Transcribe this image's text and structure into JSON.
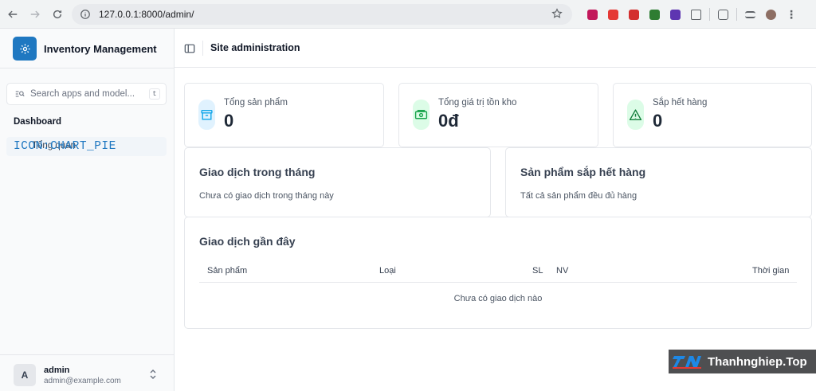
{
  "browser": {
    "url": "127.0.0.1:8000/admin/",
    "extension_colors": [
      "#c2185b",
      "#e53935",
      "#d32f2f",
      "#2e7d32",
      "#5e35b1",
      "#5f6368",
      "#5f6368",
      "#5f6368",
      "#8d6e63",
      "#5f6368"
    ]
  },
  "sidebar": {
    "brand": "Inventory Management",
    "search_placeholder": "Search apps and model...",
    "search_shortcut": "t",
    "section_title": "Dashboard",
    "nav_item_icon_text": "ICON:CHART_PIE",
    "nav_item_label": "Tổng quan",
    "user": {
      "initial": "A",
      "name": "admin",
      "email": "admin@example.com"
    }
  },
  "header": {
    "title": "Site administration"
  },
  "stats": [
    {
      "label": "Tổng sản phẩm",
      "value": "0",
      "icon": "archive-box-icon",
      "icon_color": "#0ea5e9",
      "icon_bg": "#e0f2fe"
    },
    {
      "label": "Tổng giá trị tồn kho",
      "value": "0đ",
      "icon": "banknote-icon",
      "icon_color": "#16a34a",
      "icon_bg": "#dcfce7"
    },
    {
      "label": "Sắp hết hàng",
      "value": "0",
      "icon": "warning-triangle-icon",
      "icon_color": "#15803d",
      "icon_bg": "#dcfce7"
    }
  ],
  "panels": {
    "monthly": {
      "title": "Giao dịch trong tháng",
      "text": "Chưa có giao dịch trong tháng này"
    },
    "low_stock": {
      "title": "Sản phẩm sắp hết hàng",
      "text": "Tất cả sản phẩm đều đủ hàng"
    }
  },
  "recent": {
    "title": "Giao dịch gần đây",
    "columns": {
      "product": "Sản phẩm",
      "type": "Loại",
      "qty": "SL",
      "staff": "NV",
      "time": "Thời gian"
    },
    "empty": "Chưa có giao dịch nào"
  },
  "watermark": {
    "text": "Thanhnghiep.Top",
    "logo_text": "TN"
  }
}
